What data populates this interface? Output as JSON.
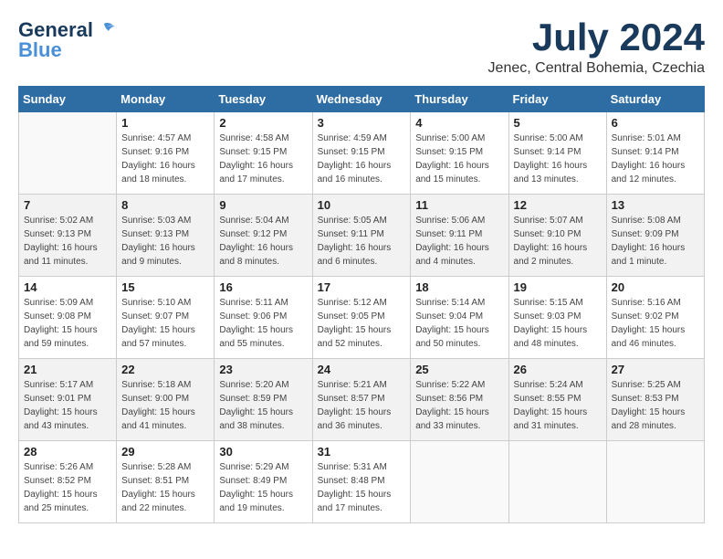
{
  "header": {
    "logo_line1": "General",
    "logo_line2": "Blue",
    "month": "July 2024",
    "location": "Jenec, Central Bohemia, Czechia"
  },
  "weekdays": [
    "Sunday",
    "Monday",
    "Tuesday",
    "Wednesday",
    "Thursday",
    "Friday",
    "Saturday"
  ],
  "weeks": [
    [
      {
        "day": "",
        "sunrise": "",
        "sunset": "",
        "daylight": ""
      },
      {
        "day": "1",
        "sunrise": "Sunrise: 4:57 AM",
        "sunset": "Sunset: 9:16 PM",
        "daylight": "Daylight: 16 hours and 18 minutes."
      },
      {
        "day": "2",
        "sunrise": "Sunrise: 4:58 AM",
        "sunset": "Sunset: 9:15 PM",
        "daylight": "Daylight: 16 hours and 17 minutes."
      },
      {
        "day": "3",
        "sunrise": "Sunrise: 4:59 AM",
        "sunset": "Sunset: 9:15 PM",
        "daylight": "Daylight: 16 hours and 16 minutes."
      },
      {
        "day": "4",
        "sunrise": "Sunrise: 5:00 AM",
        "sunset": "Sunset: 9:15 PM",
        "daylight": "Daylight: 16 hours and 15 minutes."
      },
      {
        "day": "5",
        "sunrise": "Sunrise: 5:00 AM",
        "sunset": "Sunset: 9:14 PM",
        "daylight": "Daylight: 16 hours and 13 minutes."
      },
      {
        "day": "6",
        "sunrise": "Sunrise: 5:01 AM",
        "sunset": "Sunset: 9:14 PM",
        "daylight": "Daylight: 16 hours and 12 minutes."
      }
    ],
    [
      {
        "day": "7",
        "sunrise": "Sunrise: 5:02 AM",
        "sunset": "Sunset: 9:13 PM",
        "daylight": "Daylight: 16 hours and 11 minutes."
      },
      {
        "day": "8",
        "sunrise": "Sunrise: 5:03 AM",
        "sunset": "Sunset: 9:13 PM",
        "daylight": "Daylight: 16 hours and 9 minutes."
      },
      {
        "day": "9",
        "sunrise": "Sunrise: 5:04 AM",
        "sunset": "Sunset: 9:12 PM",
        "daylight": "Daylight: 16 hours and 8 minutes."
      },
      {
        "day": "10",
        "sunrise": "Sunrise: 5:05 AM",
        "sunset": "Sunset: 9:11 PM",
        "daylight": "Daylight: 16 hours and 6 minutes."
      },
      {
        "day": "11",
        "sunrise": "Sunrise: 5:06 AM",
        "sunset": "Sunset: 9:11 PM",
        "daylight": "Daylight: 16 hours and 4 minutes."
      },
      {
        "day": "12",
        "sunrise": "Sunrise: 5:07 AM",
        "sunset": "Sunset: 9:10 PM",
        "daylight": "Daylight: 16 hours and 2 minutes."
      },
      {
        "day": "13",
        "sunrise": "Sunrise: 5:08 AM",
        "sunset": "Sunset: 9:09 PM",
        "daylight": "Daylight: 16 hours and 1 minute."
      }
    ],
    [
      {
        "day": "14",
        "sunrise": "Sunrise: 5:09 AM",
        "sunset": "Sunset: 9:08 PM",
        "daylight": "Daylight: 15 hours and 59 minutes."
      },
      {
        "day": "15",
        "sunrise": "Sunrise: 5:10 AM",
        "sunset": "Sunset: 9:07 PM",
        "daylight": "Daylight: 15 hours and 57 minutes."
      },
      {
        "day": "16",
        "sunrise": "Sunrise: 5:11 AM",
        "sunset": "Sunset: 9:06 PM",
        "daylight": "Daylight: 15 hours and 55 minutes."
      },
      {
        "day": "17",
        "sunrise": "Sunrise: 5:12 AM",
        "sunset": "Sunset: 9:05 PM",
        "daylight": "Daylight: 15 hours and 52 minutes."
      },
      {
        "day": "18",
        "sunrise": "Sunrise: 5:14 AM",
        "sunset": "Sunset: 9:04 PM",
        "daylight": "Daylight: 15 hours and 50 minutes."
      },
      {
        "day": "19",
        "sunrise": "Sunrise: 5:15 AM",
        "sunset": "Sunset: 9:03 PM",
        "daylight": "Daylight: 15 hours and 48 minutes."
      },
      {
        "day": "20",
        "sunrise": "Sunrise: 5:16 AM",
        "sunset": "Sunset: 9:02 PM",
        "daylight": "Daylight: 15 hours and 46 minutes."
      }
    ],
    [
      {
        "day": "21",
        "sunrise": "Sunrise: 5:17 AM",
        "sunset": "Sunset: 9:01 PM",
        "daylight": "Daylight: 15 hours and 43 minutes."
      },
      {
        "day": "22",
        "sunrise": "Sunrise: 5:18 AM",
        "sunset": "Sunset: 9:00 PM",
        "daylight": "Daylight: 15 hours and 41 minutes."
      },
      {
        "day": "23",
        "sunrise": "Sunrise: 5:20 AM",
        "sunset": "Sunset: 8:59 PM",
        "daylight": "Daylight: 15 hours and 38 minutes."
      },
      {
        "day": "24",
        "sunrise": "Sunrise: 5:21 AM",
        "sunset": "Sunset: 8:57 PM",
        "daylight": "Daylight: 15 hours and 36 minutes."
      },
      {
        "day": "25",
        "sunrise": "Sunrise: 5:22 AM",
        "sunset": "Sunset: 8:56 PM",
        "daylight": "Daylight: 15 hours and 33 minutes."
      },
      {
        "day": "26",
        "sunrise": "Sunrise: 5:24 AM",
        "sunset": "Sunset: 8:55 PM",
        "daylight": "Daylight: 15 hours and 31 minutes."
      },
      {
        "day": "27",
        "sunrise": "Sunrise: 5:25 AM",
        "sunset": "Sunset: 8:53 PM",
        "daylight": "Daylight: 15 hours and 28 minutes."
      }
    ],
    [
      {
        "day": "28",
        "sunrise": "Sunrise: 5:26 AM",
        "sunset": "Sunset: 8:52 PM",
        "daylight": "Daylight: 15 hours and 25 minutes."
      },
      {
        "day": "29",
        "sunrise": "Sunrise: 5:28 AM",
        "sunset": "Sunset: 8:51 PM",
        "daylight": "Daylight: 15 hours and 22 minutes."
      },
      {
        "day": "30",
        "sunrise": "Sunrise: 5:29 AM",
        "sunset": "Sunset: 8:49 PM",
        "daylight": "Daylight: 15 hours and 19 minutes."
      },
      {
        "day": "31",
        "sunrise": "Sunrise: 5:31 AM",
        "sunset": "Sunset: 8:48 PM",
        "daylight": "Daylight: 15 hours and 17 minutes."
      },
      {
        "day": "",
        "sunrise": "",
        "sunset": "",
        "daylight": ""
      },
      {
        "day": "",
        "sunrise": "",
        "sunset": "",
        "daylight": ""
      },
      {
        "day": "",
        "sunrise": "",
        "sunset": "",
        "daylight": ""
      }
    ]
  ]
}
